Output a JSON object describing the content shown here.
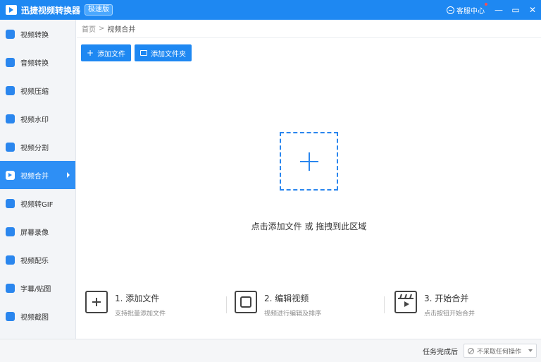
{
  "app": {
    "title": "迅捷视频转换器",
    "edition": "极速版",
    "service_label": "客服中心",
    "window_controls": {
      "minimize": "—",
      "restore": "▭",
      "close": "✕"
    }
  },
  "sidebar": {
    "items": [
      {
        "label": "视频转换",
        "icon": "video-convert-icon"
      },
      {
        "label": "音频转换",
        "icon": "audio-convert-icon"
      },
      {
        "label": "视频压缩",
        "icon": "video-compress-icon"
      },
      {
        "label": "视频水印",
        "icon": "watermark-icon"
      },
      {
        "label": "视频分割",
        "icon": "split-icon"
      },
      {
        "label": "视频合并",
        "icon": "merge-icon",
        "active": true
      },
      {
        "label": "视频转GIF",
        "icon": "gif-icon"
      },
      {
        "label": "屏幕录像",
        "icon": "screen-record-icon"
      },
      {
        "label": "视频配乐",
        "icon": "music-icon"
      },
      {
        "label": "字幕/贴图",
        "icon": "subtitle-icon"
      },
      {
        "label": "视频截图",
        "icon": "screenshot-icon"
      }
    ]
  },
  "breadcrumb": {
    "home": "首页",
    "separator": ">",
    "current": "视频合并"
  },
  "toolbar": {
    "add_file": "添加文件",
    "add_folder": "添加文件夹"
  },
  "drop_zone": {
    "hint": "点击添加文件 或 拖拽到此区域"
  },
  "steps": [
    {
      "title": "1. 添加文件",
      "desc": "支持批量添加文件",
      "icon": "add-file-icon"
    },
    {
      "title": "2. 编辑视频",
      "desc": "视频进行编辑及排序",
      "icon": "edit-video-icon"
    },
    {
      "title": "3. 开始合并",
      "desc": "点击按钮开始合并",
      "icon": "clapper-icon"
    }
  ],
  "status": {
    "task_label": "任务完成后",
    "task_option": "不采取任何操作"
  },
  "colors": {
    "accent": "#1e88f2",
    "active": "#2e8ff5",
    "sidebar_bg": "#f3f5f8"
  }
}
